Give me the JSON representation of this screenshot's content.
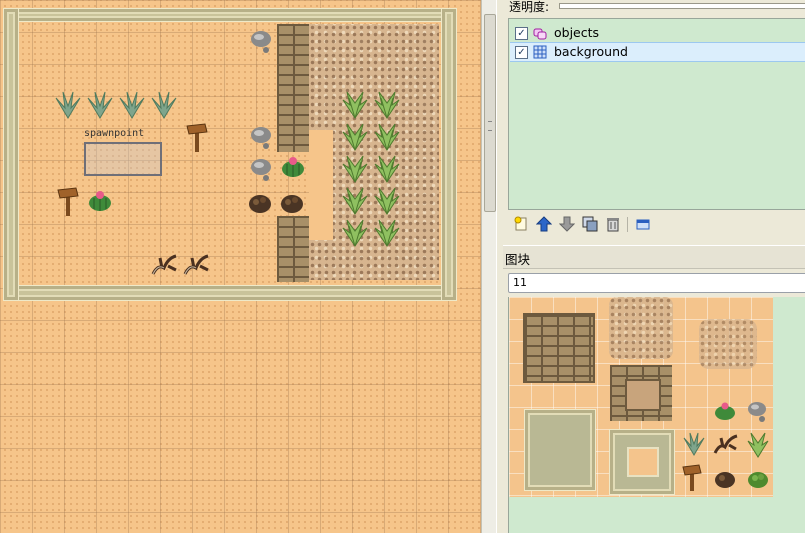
{
  "map": {
    "spawnpoint_label": "spawnpoint"
  },
  "panel": {
    "opacity_label": "透明度:",
    "layers": [
      {
        "name": "objects",
        "checked": true,
        "icon": "objects-layer-icon"
      },
      {
        "name": "background",
        "checked": true,
        "icon": "tile-layer-icon",
        "selected": true
      }
    ],
    "toolbar": [
      {
        "icon": "new-layer-icon",
        "title": "new layer"
      },
      {
        "icon": "arrow-up-icon",
        "title": "raise layer"
      },
      {
        "icon": "arrow-down-icon",
        "title": "lower layer"
      },
      {
        "icon": "duplicate-layer-icon",
        "title": "duplicate layer"
      },
      {
        "icon": "delete-layer-icon",
        "title": "delete layer"
      },
      {
        "icon": "layer-properties-icon",
        "title": "layer properties"
      }
    ],
    "tileset_header": "图块",
    "tileset_selected": "11"
  },
  "colors": {
    "sand": "#f6c58a",
    "layer_panel_bg": "#cfe9cf",
    "selection": "#dbeefc"
  }
}
